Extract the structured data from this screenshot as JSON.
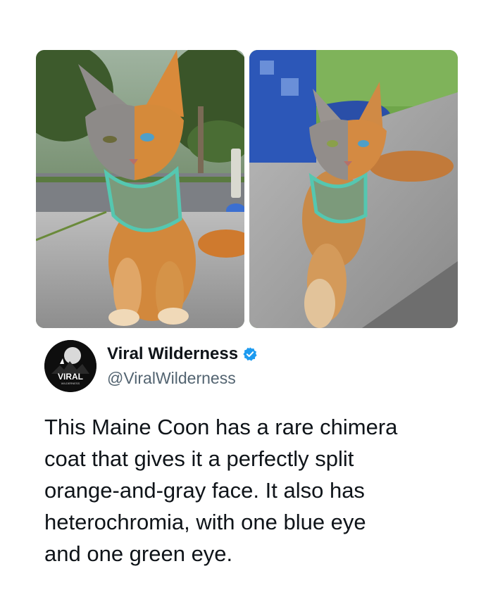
{
  "post": {
    "author": {
      "display_name": "Viral Wilderness",
      "handle": "@ViralWilderness",
      "verified": true,
      "avatar_text": "VIRAL",
      "avatar_subtext": "WILDERNESS",
      "verified_color": "#1d9bf0"
    },
    "text_lines": [
      "This Maine Coon has a rare chimera",
      "coat that gives it a perfectly split",
      "orange-and-gray face. It also has",
      "heterochromia, with one blue eye",
      "and one green eye."
    ],
    "media": [
      {
        "icon": "cat-sitting-photo"
      },
      {
        "icon": "cat-lying-photo"
      }
    ]
  }
}
